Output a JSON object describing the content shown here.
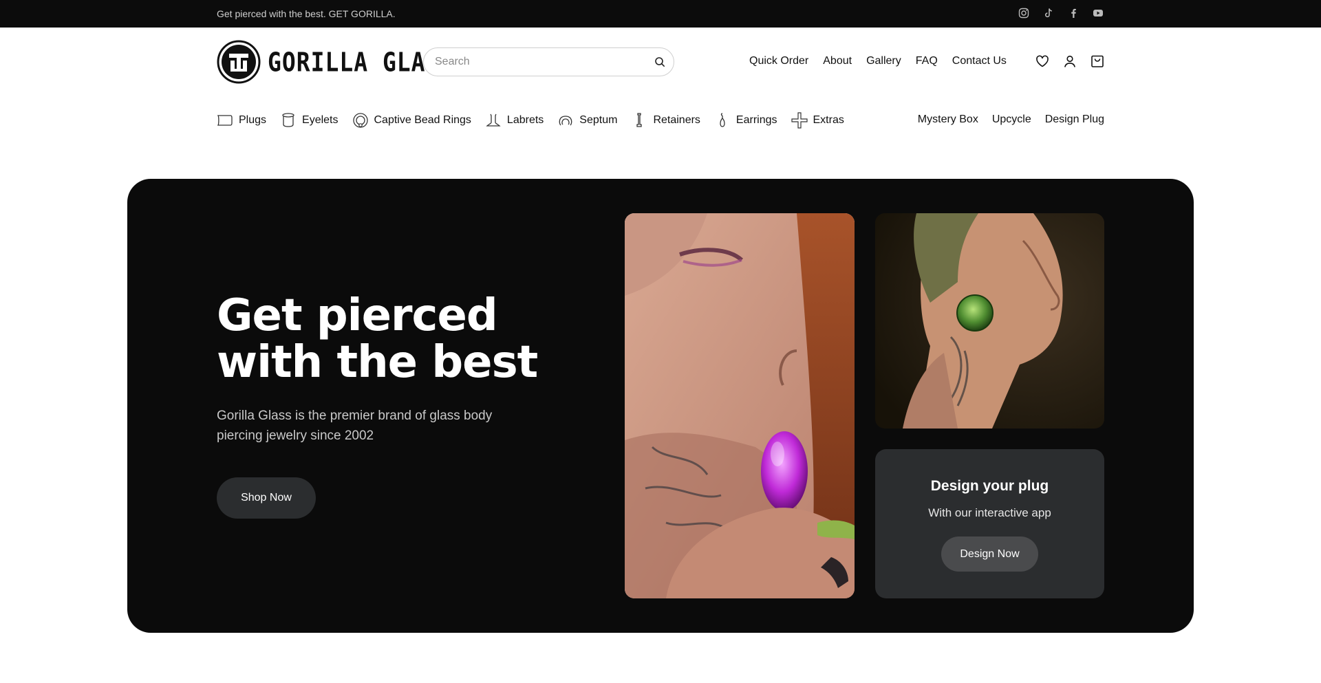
{
  "announcement": {
    "text": "Get pierced with the best. GET GORILLA."
  },
  "social": [
    "instagram-icon",
    "tiktok-icon",
    "facebook-icon",
    "youtube-icon"
  ],
  "brand": {
    "name": "GORILLA GLASS"
  },
  "search": {
    "placeholder": "Search"
  },
  "main_nav": [
    "Quick Order",
    "About",
    "Gallery",
    "FAQ",
    "Contact Us"
  ],
  "header_icons": [
    "heart-icon",
    "user-icon",
    "cart-icon"
  ],
  "categories": [
    {
      "label": "Plugs",
      "icon": "plug-icon"
    },
    {
      "label": "Eyelets",
      "icon": "eyelet-icon"
    },
    {
      "label": "Captive Bead Rings",
      "icon": "ring-icon"
    },
    {
      "label": "Labrets",
      "icon": "labret-icon"
    },
    {
      "label": "Septum",
      "icon": "septum-icon"
    },
    {
      "label": "Retainers",
      "icon": "retainer-icon"
    },
    {
      "label": "Earrings",
      "icon": "earring-icon"
    },
    {
      "label": "Extras",
      "icon": "plus-icon"
    }
  ],
  "extra_nav": [
    "Mystery Box",
    "Upcycle",
    "Design Plug"
  ],
  "hero": {
    "title_line1": "Get pierced",
    "title_line2": "with the best",
    "subtitle": "Gorilla Glass is the premier brand of glass body piercing jewelry since 2002",
    "cta": "Shop Now"
  },
  "design_card": {
    "title": "Design your plug",
    "subtitle": "With our interactive app",
    "cta": "Design Now"
  },
  "colors": {
    "topbar": "#0c0c0c",
    "hero_bg": "#0b0b0b",
    "button_dark": "#2b2d2f",
    "card_bg": "#2b2d2f",
    "design_button": "#4a4b4d"
  }
}
